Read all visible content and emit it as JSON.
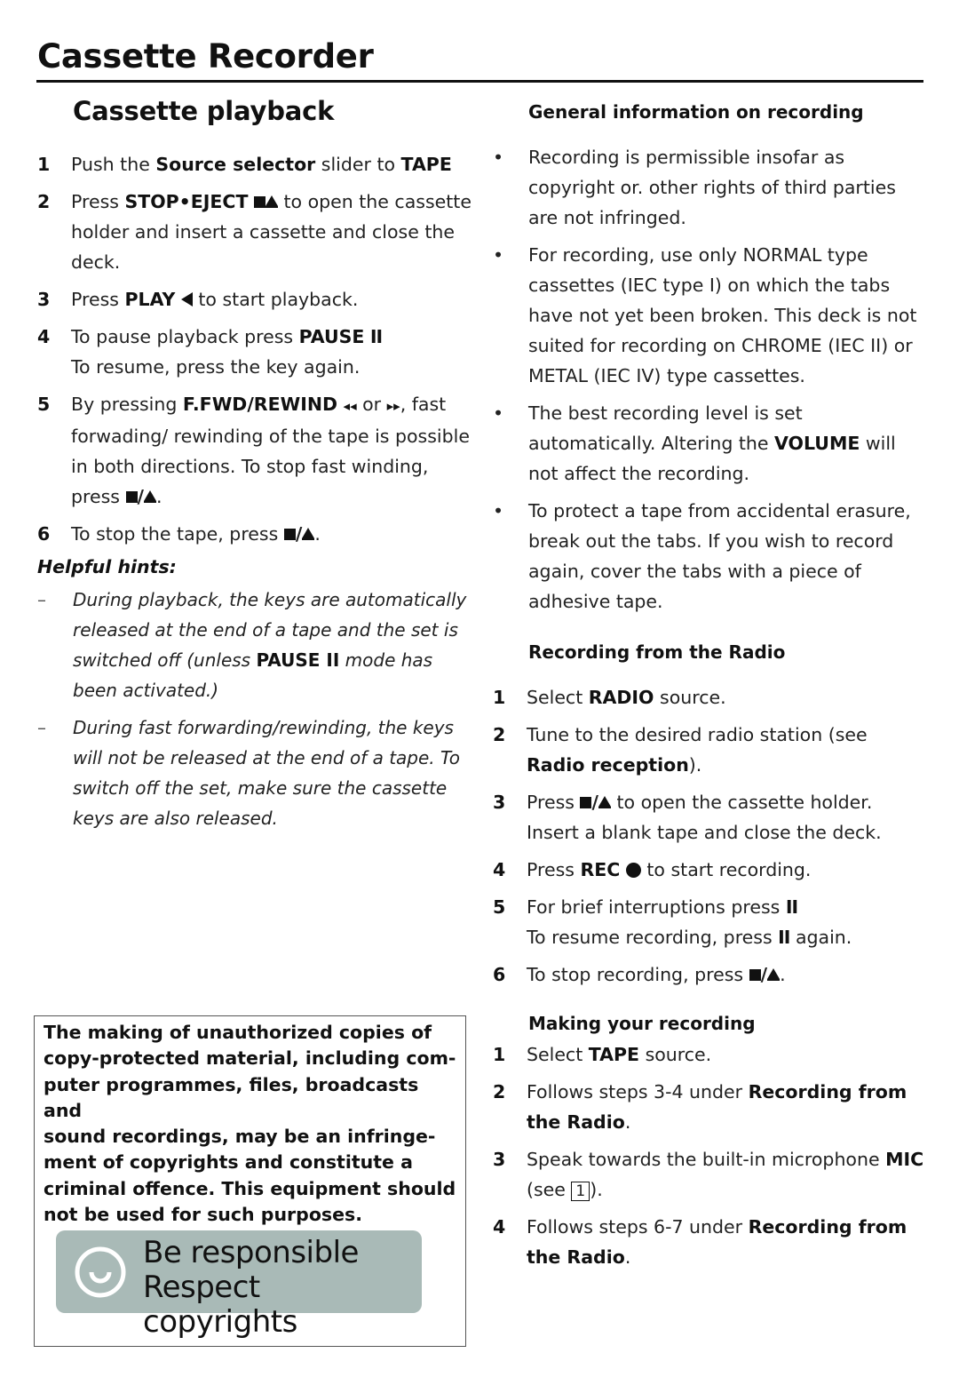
{
  "page": {
    "title": "Cassette Recorder"
  },
  "playback": {
    "title": "Cassette playback",
    "steps": [
      {
        "num": "1",
        "parts": [
          "Push the ",
          "Source selector",
          " slider to ",
          "TAPE"
        ]
      },
      {
        "num": "2",
        "pre": "Press ",
        "bold": "STOP•EJECT",
        "post": " to open the cassette holder and insert a cassette and close the deck.",
        "icon": "stop-eject-icon"
      },
      {
        "num": "3",
        "pre": "Press ",
        "bold": "PLAY",
        "post": " to start playback.",
        "icon": "play-icon"
      },
      {
        "num": "4",
        "pre": "To pause playback press ",
        "bold": "PAUSE",
        "pause_glyph": "II",
        "line2": "To resume, press the key again."
      },
      {
        "num": "5",
        "pre": "By pressing ",
        "bold": "F.FWD/REWIND",
        "rewind_glyph": "◂◂",
        "mid": " or ",
        "ffwd_glyph": "▸▸",
        "post": ", fast forwading/ rewinding of the tape is possible in both directions. To stop fast winding, press",
        "end": "."
      },
      {
        "num": "6",
        "pre": "To stop the tape, press",
        "end": "."
      }
    ],
    "hints_title": "Helpful hints:",
    "hints": [
      {
        "mark": "–",
        "pre": "During playback, the keys are automatically released at the end of a tape and the set is switched off (unless ",
        "bold": "PAUSE II",
        "post": " mode has been activated.)"
      },
      {
        "mark": "–",
        "text": "During fast forwarding/rewinding, the keys will not  be released at the end of a tape. To switch off the set, make sure the cassette keys are also released."
      }
    ]
  },
  "notice": {
    "text": "The making of unauthorized copies of copy-protected material, including computer programmes, files, broadcasts and sound recordings, may be an infringement of copyrights and constitute a criminal offence. This equipment should not be used for such purposes.",
    "lines": [
      "The making of unauthorized copies of",
      "copy-protected material, including com-",
      "puter programmes, files, broadcasts and",
      "sound recordings, may be an infringe-",
      "ment of copyrights and constitute a",
      "criminal offence. This equipment should",
      "not be used for such purposes."
    ],
    "banner": {
      "line1": "Be responsible",
      "line2": "Respect copyrights",
      "icon": "respect-copyright-icon",
      "color": "#a9bab7"
    }
  },
  "general_info": {
    "title": "General information on recording",
    "bullets": [
      {
        "mark": "•",
        "text": "Recording is permissible insofar as copyright or. other rights of third parties are not infringed."
      },
      {
        "mark": "•",
        "text": "For recording, use only NORMAL type cassettes (IEC type I) on which the tabs have not yet been broken. This deck is not suited for recording on CHROME (IEC II) or METAL (IEC IV) type cassettes."
      },
      {
        "mark": "•",
        "pre": "The best recording level is set automatically. Altering the ",
        "bold": "VOLUME",
        "post": " will not affect the recording."
      },
      {
        "mark": "•",
        "text": "To protect a tape from accidental erasure, break out the tabs. If you wish to record again, cover the tabs with a piece of adhesive tape."
      }
    ]
  },
  "radio_recording": {
    "title": "Recording from the Radio",
    "steps": [
      {
        "num": "1",
        "pre": "Select ",
        "bold": "RADIO",
        "post": " source."
      },
      {
        "num": "2",
        "pre": "Tune to the desired radio station (see ",
        "bold": "Radio reception",
        "post": ")."
      },
      {
        "num": "3",
        "pre": "Press",
        "post": " to open the cassette holder. Insert a blank tape and close the deck."
      },
      {
        "num": "4",
        "pre": "Press ",
        "bold": "REC",
        "post": " to start recording."
      },
      {
        "num": "5",
        "pre": "For brief interruptions press",
        "pause_glyph": "II",
        "line2_pre": "To resume recording, press ",
        "line2_post": " again."
      },
      {
        "num": "6",
        "pre": "To stop recording, press",
        "end": "."
      }
    ]
  },
  "making_recording": {
    "title": "Making your recording",
    "steps": [
      {
        "num": "1",
        "pre": "Select ",
        "bold": "TAPE",
        "post": " source."
      },
      {
        "num": "2",
        "pre": "Follows steps 3-4 under ",
        "bold": "Recording from the Radio",
        "post": "."
      },
      {
        "num": "3",
        "pre": "Speak towards the built-in microphone ",
        "bold": "MIC",
        "mid": " (see ",
        "boxed": "1",
        "post": ")."
      },
      {
        "num": "4",
        "pre": "Follows steps 6-7 under ",
        "bold": "Recording from the Radio",
        "post": "."
      }
    ]
  }
}
